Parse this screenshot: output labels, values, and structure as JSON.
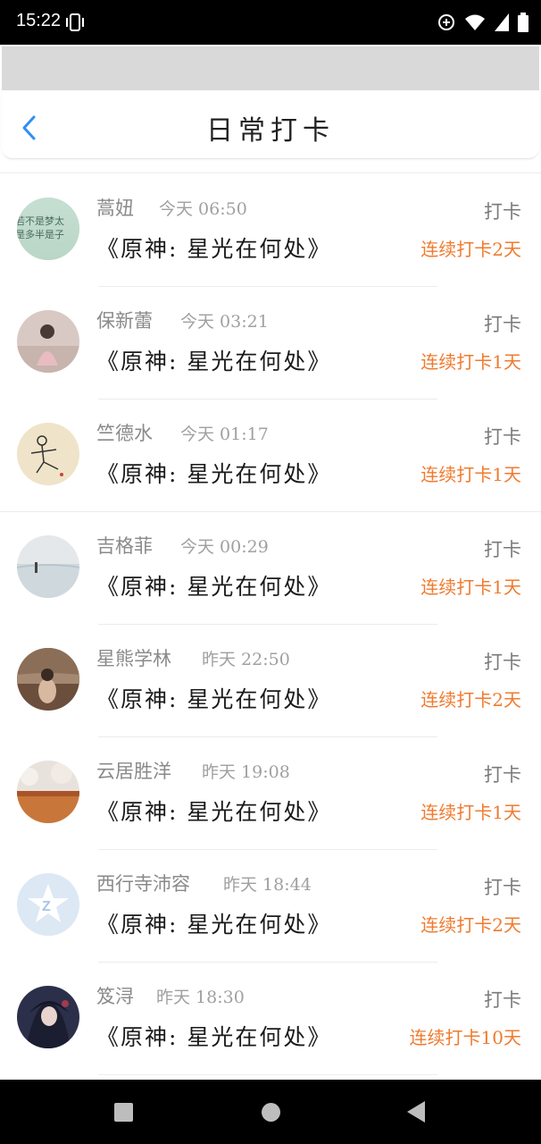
{
  "status_bar": {
    "time": "15:22"
  },
  "header": {
    "title": "日常打卡"
  },
  "entries": [
    {
      "name": "蒿妞",
      "time": "今天 06:50",
      "book": "《原神: 星光在何处》",
      "action": "打卡",
      "streak": "连续打卡2天"
    },
    {
      "name": "保新蕾",
      "time": "今天 03:21",
      "book": "《原神: 星光在何处》",
      "action": "打卡",
      "streak": "连续打卡1天"
    },
    {
      "name": "竺德水",
      "time": "今天 01:17",
      "book": "《原神: 星光在何处》",
      "action": "打卡",
      "streak": "连续打卡1天"
    },
    {
      "name": "吉格菲",
      "time": "今天 00:29",
      "book": "《原神: 星光在何处》",
      "action": "打卡",
      "streak": "连续打卡1天"
    },
    {
      "name": "星熊学林",
      "time": "昨天 22:50",
      "book": "《原神: 星光在何处》",
      "action": "打卡",
      "streak": "连续打卡2天"
    },
    {
      "name": "云居胜洋",
      "time": "昨天 19:08",
      "book": "《原神: 星光在何处》",
      "action": "打卡",
      "streak": "连续打卡1天"
    },
    {
      "name": "西行寺沛容",
      "time": "昨天 18:44",
      "book": "《原神: 星光在何处》",
      "action": "打卡",
      "streak": "连续打卡2天"
    },
    {
      "name": "笈浔",
      "time": "昨天 18:30",
      "book": "《原神: 星光在何处》",
      "action": "打卡",
      "streak": "连续打卡10天"
    }
  ],
  "avatar_text": {
    "line1": "若不是梦太",
    "line2": "是多半是子"
  }
}
